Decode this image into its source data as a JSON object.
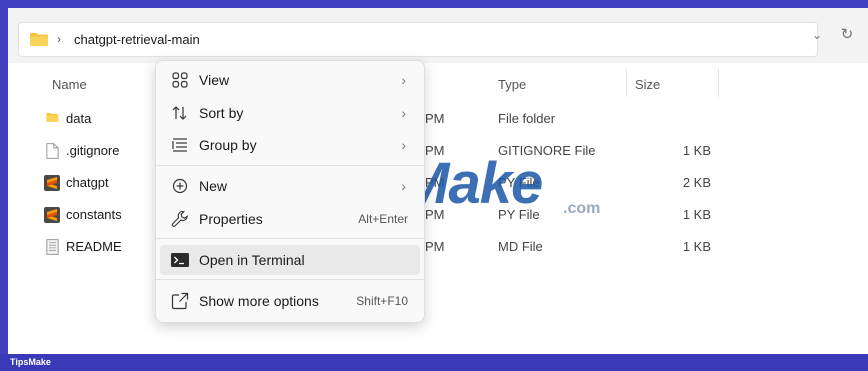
{
  "address_bar": {
    "path": "chatgpt-retrieval-main",
    "separator": "›",
    "dropdown_icon": "chevron-down-icon",
    "refresh_icon": "refresh-icon"
  },
  "columns": {
    "name": "Name",
    "type": "Type",
    "size": "Size"
  },
  "files": [
    {
      "name": "data",
      "date_suffix": "",
      "type": "File folder",
      "size": "",
      "icon": "folder-icon"
    },
    {
      "name": ".gitignore",
      "date_suffix": "PM",
      "type": "GITIGNORE File",
      "size": "1 KB",
      "icon": "file-icon"
    },
    {
      "name": "chatgpt",
      "date_suffix": "PM",
      "type": "PY File",
      "size": "2 KB",
      "icon": "sublime-icon"
    },
    {
      "name": "constants",
      "date_suffix": "PM",
      "type": "PY File",
      "size": "1 KB",
      "icon": "sublime-icon"
    },
    {
      "name": "README",
      "date_suffix": "PM",
      "type": "MD File",
      "size": "1 KB",
      "icon": "text-file-icon"
    }
  ],
  "first_row_date_suffix": "PM",
  "context_menu": {
    "items": [
      {
        "label": "View",
        "icon": "view-grid-icon",
        "arrow": "›"
      },
      {
        "label": "Sort by",
        "icon": "sort-icon",
        "arrow": "›"
      },
      {
        "label": "Group by",
        "icon": "group-icon",
        "arrow": "›"
      },
      {
        "label": "New",
        "icon": "plus-circle-icon",
        "arrow": "›"
      },
      {
        "label": "Properties",
        "icon": "wrench-icon",
        "shortcut": "Alt+Enter"
      },
      {
        "label": "Open in Terminal",
        "icon": "terminal-icon"
      },
      {
        "label": "Show more options",
        "icon": "share-icon",
        "shortcut": "Shift+F10"
      }
    ]
  },
  "watermark": {
    "text": "TipsMake",
    "suffix": ".com"
  },
  "footer": {
    "text": "TipsMake"
  }
}
